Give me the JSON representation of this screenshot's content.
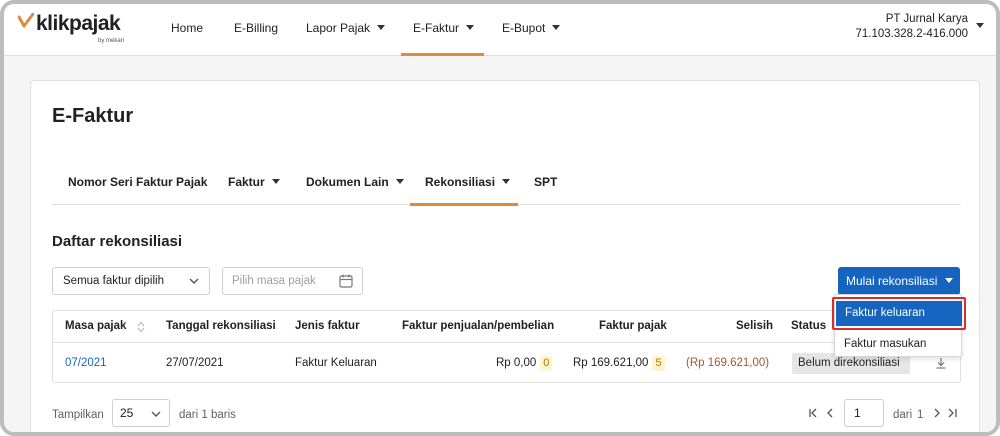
{
  "brand": {
    "name": "klikpajak",
    "sub": "by mekari",
    "accent": "#e08a3c"
  },
  "nav": {
    "items": [
      {
        "label": "Home"
      },
      {
        "label": "E-Billing"
      },
      {
        "label": "Lapor Pajak"
      },
      {
        "label": "E-Faktur"
      },
      {
        "label": "E-Bupot"
      }
    ],
    "company_name": "PT Jurnal Karya",
    "company_npwp": "71.103.328.2-416.000"
  },
  "page": {
    "title": "E-Faktur",
    "tabs": [
      {
        "label": "Nomor Seri Faktur Pajak"
      },
      {
        "label": "Faktur"
      },
      {
        "label": "Dokumen Lain"
      },
      {
        "label": "Rekonsiliasi"
      },
      {
        "label": "SPT"
      }
    ],
    "section_title": "Daftar rekonsiliasi"
  },
  "filters": {
    "faktur_select": "Semua faktur dipilih",
    "masa_pajak_placeholder": "Pilih masa pajak",
    "start_button": "Mulai rekonsiliasi"
  },
  "dropdown": {
    "items": [
      {
        "label": "Faktur keluaran"
      },
      {
        "label": "Faktur masukan"
      }
    ]
  },
  "table": {
    "headers": [
      "Masa pajak",
      "Tanggal rekonsiliasi",
      "Jenis faktur",
      "Faktur penjualan/pembelian",
      "Faktur pajak",
      "Selisih",
      "Status"
    ],
    "rows": [
      {
        "masa": "07/2021",
        "tanggal": "27/07/2021",
        "jenis": "Faktur Keluaran",
        "penjualan": "Rp 0,00",
        "penjualan_count": "0",
        "pajak": "Rp 169.621,00",
        "pajak_count": "5",
        "selisih": "(Rp 169.621,00)",
        "status": "Belum direkonsiliasi"
      }
    ]
  },
  "footer": {
    "show_label": "Tampilkan",
    "page_size": "25",
    "rows_text": "dari 1 baris",
    "page": "1",
    "of_text": "dari",
    "total_pages": "1"
  }
}
